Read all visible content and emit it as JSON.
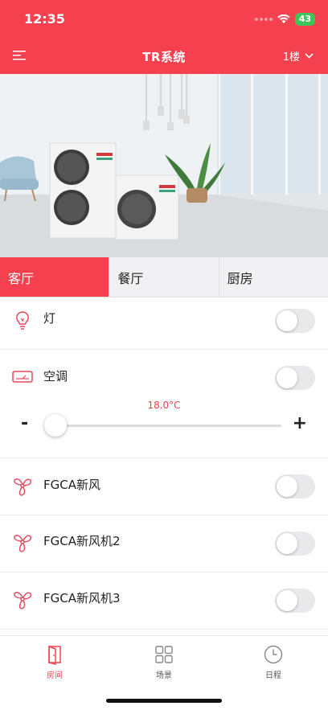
{
  "status": {
    "time": "12:35",
    "battery": "43"
  },
  "header": {
    "title": "TR系统",
    "floor": "1楼"
  },
  "tabs": [
    {
      "label": "客厅",
      "active": true
    },
    {
      "label": "餐厅",
      "active": false
    },
    {
      "label": "厨房",
      "active": false
    }
  ],
  "devices": [
    {
      "name": "灯",
      "icon": "bulb-icon",
      "on": false
    },
    {
      "name": "空调",
      "icon": "air-conditioner-icon",
      "on": false
    },
    {
      "name": "FGCA新风",
      "icon": "fan-icon",
      "on": false
    },
    {
      "name": "FGCA新风机2",
      "icon": "fan-icon",
      "on": false
    },
    {
      "name": "FGCA新风机3",
      "icon": "fan-icon",
      "on": false
    }
  ],
  "ac": {
    "temperature": "18.0°C",
    "level": 0.0,
    "minus": "-",
    "plus": "+"
  },
  "nav": [
    {
      "label": "房间",
      "icon": "door-icon",
      "active": true
    },
    {
      "label": "场景",
      "icon": "grid-icon",
      "active": false
    },
    {
      "label": "日程",
      "icon": "clock-icon",
      "active": false
    }
  ],
  "colors": {
    "accent": "#f5414f",
    "battery": "#3dc55a"
  }
}
